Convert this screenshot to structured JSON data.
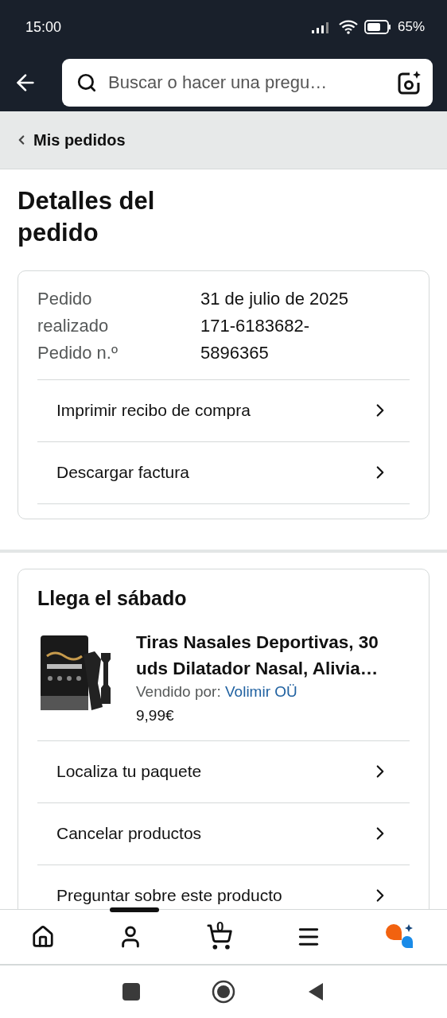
{
  "status_bar": {
    "time": "15:00",
    "battery": "65%"
  },
  "search": {
    "placeholder": "Buscar o hacer una pregu…"
  },
  "breadcrumb": {
    "label": "Mis pedidos"
  },
  "title": "Detalles del pedido",
  "order_info": {
    "labels": [
      "Pedido realizado",
      "Pedido n.º"
    ],
    "values": [
      "31 de julio de 2025",
      "171-6183682-5896365"
    ],
    "actions": [
      "Imprimir recibo de compra",
      "Descargar factura"
    ]
  },
  "shipment": {
    "heading": "Llega el sábado",
    "product": {
      "kind": "picture",
      "title": "Tiras Nasales Deportivas, 30 uds Dilatador Nasal, Alivia…",
      "seller_label": "Vendido por:",
      "seller": "Volimir OÜ",
      "price": "9,99€"
    },
    "actions": [
      "Localiza tu paquete",
      "Cancelar productos",
      "Preguntar sobre este producto"
    ]
  },
  "bottom_nav": {
    "cart_count": "0"
  }
}
